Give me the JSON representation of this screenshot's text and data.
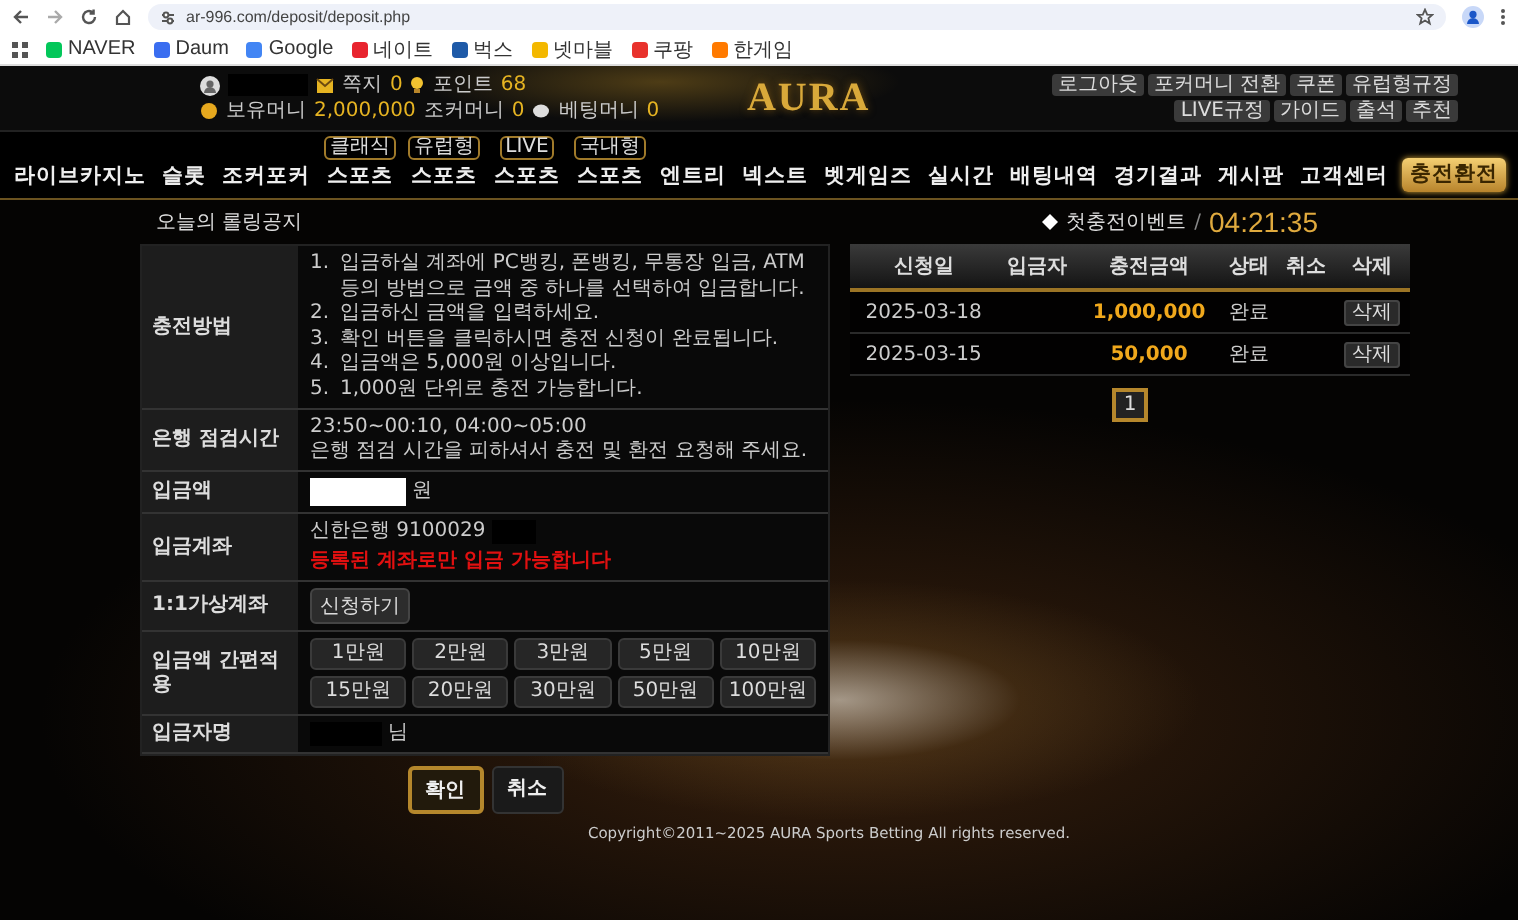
{
  "browser": {
    "url": "ar-996.com/deposit/deposit.php",
    "bookmarks": [
      {
        "label": "NAVER"
      },
      {
        "label": "Daum"
      },
      {
        "label": "Google"
      },
      {
        "label": "네이트"
      },
      {
        "label": "벅스"
      },
      {
        "label": "넷마블"
      },
      {
        "label": "쿠팡"
      },
      {
        "label": "한게임"
      }
    ]
  },
  "header": {
    "messages_label": "쪽지",
    "messages": "0",
    "points_label": "포인트",
    "points": "68",
    "money": [
      {
        "label": "보유머니",
        "value": "2,000,000"
      },
      {
        "label": "조커머니",
        "value": "0"
      },
      {
        "label": "베팅머니",
        "value": "0"
      }
    ],
    "logo": "AURA",
    "top_buttons": [
      "로그아웃",
      "포커머니 전환",
      "쿠폰",
      "유럽형규정",
      "LIVE규정",
      "가이드",
      "출석",
      "추천"
    ],
    "nav": [
      {
        "label": "라이브카지노",
        "selected": false
      },
      {
        "label": "슬롯",
        "selected": false
      },
      {
        "label": "조커포커",
        "selected": false
      },
      {
        "label": "스포츠",
        "badge": "클래식",
        "selected": false
      },
      {
        "label": "스포츠",
        "badge": "유럽형",
        "selected": false
      },
      {
        "label": "스포츠",
        "badge": "LIVE",
        "selected": false
      },
      {
        "label": "스포츠",
        "badge": "국내형",
        "selected": false
      },
      {
        "label": "엔트리",
        "selected": false
      },
      {
        "label": "넥스트",
        "selected": false
      },
      {
        "label": "벳게임즈",
        "selected": false
      },
      {
        "label": "실시간",
        "selected": false
      },
      {
        "label": "배팅내역",
        "selected": false
      },
      {
        "label": "경기결과",
        "selected": false
      },
      {
        "label": "게시판",
        "selected": false
      },
      {
        "label": "고객센터",
        "selected": false
      },
      {
        "label": "충전환전",
        "selected": true
      }
    ]
  },
  "notice": {
    "title": "오늘의 롤링공지",
    "event": "첫충전이벤트",
    "separator": "/",
    "time": "04:21:35"
  },
  "form": {
    "rows": [
      {
        "kind": "steps",
        "label": "충전방법",
        "steps": [
          {
            "marker": "1.",
            "text": "입금하실 계좌에 PC뱅킹, 폰뱅킹, 무통장 입금, ATM 등의 방법으로 금액 중 하나를 선택하여 입금합니다."
          },
          {
            "marker": "2.",
            "text": "입금하신 금액을 입력하세요."
          },
          {
            "marker": "3.",
            "text": "확인 버튼을 클릭하시면 충전 신청이 완료됩니다."
          },
          {
            "marker": "4.",
            "text": "입금액은 5,000원 이상입니다."
          },
          {
            "marker": "5.",
            "text": "1,000원 단위로 충전 가능합니다."
          }
        ]
      },
      {
        "kind": "lines",
        "label": "은행 점검시간",
        "lines": [
          "23:50~00:10, 04:00~05:00",
          "은행 점검 시간을 피하셔서 충전 및 환전 요청해 주세요."
        ]
      },
      {
        "kind": "input",
        "label": "입금액",
        "unit": "원"
      },
      {
        "kind": "account",
        "label": "입금계좌",
        "account": "신한은행 9100029",
        "warning": "등록된 계좌로만 입금 가능합니다"
      },
      {
        "kind": "button",
        "label": "1:1가상계좌",
        "button": "신청하기"
      },
      {
        "kind": "quick",
        "label": "입금액 간편적용",
        "amounts": [
          "1만원",
          "2만원",
          "3만원",
          "5만원",
          "10만원",
          "15만원",
          "20만원",
          "30만원",
          "50만원",
          "100만원"
        ]
      },
      {
        "kind": "depositor",
        "label": "입금자명",
        "suffix": "님"
      }
    ],
    "actions": [
      {
        "label": "확인",
        "kind": "primary"
      },
      {
        "label": "취소",
        "kind": "secondary"
      }
    ]
  },
  "history": {
    "columns": [
      "신청일",
      "입금자",
      "충전금액",
      "상태",
      "취소",
      "삭제"
    ],
    "rows": [
      {
        "date": "2025-03-18",
        "amount": "1,000,000",
        "status": "완료",
        "delete": "삭제"
      },
      {
        "date": "2025-03-15",
        "amount": "50,000",
        "status": "완료",
        "delete": "삭제"
      }
    ],
    "pages": [
      {
        "label": "1",
        "selected": true
      }
    ]
  },
  "footer": {
    "copyright": "Copyright©2011~2025 AURA Sports Betting All rights reserved."
  }
}
